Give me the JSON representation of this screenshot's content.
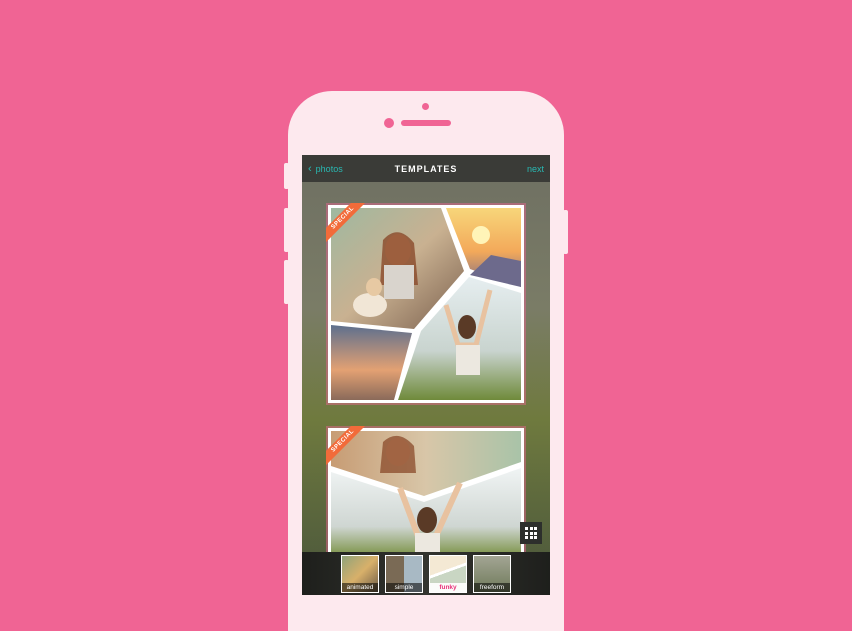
{
  "nav": {
    "back_label": "photos",
    "title": "TEMPLATES",
    "next_label": "next"
  },
  "cards": [
    {
      "badge": "SPECIAL"
    },
    {
      "badge": "SPECIAL"
    }
  ],
  "tabs": [
    {
      "label": "animated",
      "active": false
    },
    {
      "label": "simple",
      "active": false
    },
    {
      "label": "funky",
      "active": true
    },
    {
      "label": "freeform",
      "active": false
    }
  ],
  "colors": {
    "background": "#f06494",
    "phone": "#fde9ee",
    "accent": "#29b8b2",
    "badge": "#f26b3a",
    "active_tab": "#e8327a"
  },
  "icons": [
    "chevron-left-icon",
    "grid-icon"
  ]
}
